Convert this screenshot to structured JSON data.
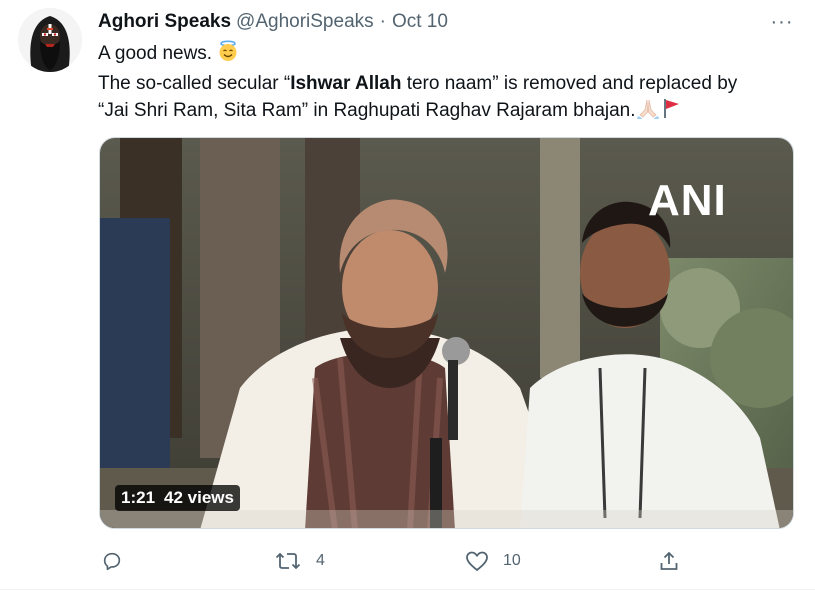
{
  "tweet": {
    "author": {
      "name": "Aghori Speaks",
      "handle": "@AghoriSpeaks",
      "separator": "·",
      "time": "Oct 10"
    },
    "more_label": "···",
    "text": {
      "line1": "A good news. ",
      "line2_before": "The so-called secular “",
      "line2_bold": "Ishwar Allah",
      "line2_after": " tero naam” is removed and replaced by",
      "line3": "“Jai Shri Ram, Sita Ram” in Raghupati Raghav Rajaram bhajan."
    },
    "emojis": [
      "smiling-face-with-halo",
      "folded-hands",
      "triangular-flag"
    ],
    "media": {
      "watermark": "ANI",
      "duration": "1:21",
      "views": "42 views"
    },
    "actions": {
      "reply_count": "",
      "retweet_count": "4",
      "like_count": "10",
      "share_count": ""
    },
    "icons": [
      "reply-icon",
      "retweet-icon",
      "like-icon",
      "share-icon",
      "more-icon",
      "play-video"
    ],
    "colors": {
      "text_primary": "#0f1419",
      "text_secondary": "#536471",
      "border": "#cfd9de",
      "flag_red": "#dd2e44"
    }
  }
}
